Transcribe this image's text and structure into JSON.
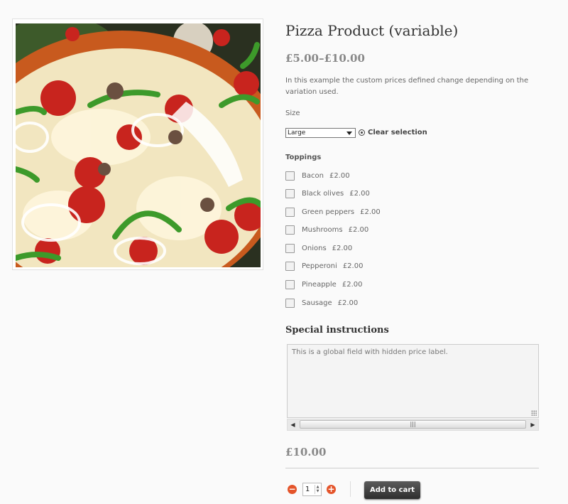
{
  "product": {
    "title": "Pizza Product (variable)",
    "price_range": "£5.00–£10.00",
    "description": "In this example the custom prices defined change depending on the variation used.",
    "image_icon": "pizza-photo"
  },
  "variation": {
    "label": "Size",
    "selected": "Large",
    "clear_label": "Clear selection"
  },
  "toppings": {
    "label": "Toppings",
    "items": [
      {
        "name": "Bacon",
        "price": "£2.00",
        "checked": false
      },
      {
        "name": "Black olives",
        "price": "£2.00",
        "checked": false
      },
      {
        "name": "Green peppers",
        "price": "£2.00",
        "checked": false
      },
      {
        "name": "Mushrooms",
        "price": "£2.00",
        "checked": false
      },
      {
        "name": "Onions",
        "price": "£2.00",
        "checked": false
      },
      {
        "name": "Pepperoni",
        "price": "£2.00",
        "checked": false
      },
      {
        "name": "Pineapple",
        "price": "£2.00",
        "checked": false
      },
      {
        "name": "Sausage",
        "price": "£2.00",
        "checked": false
      }
    ]
  },
  "special": {
    "heading": "Special instructions",
    "placeholder": "This is a global field with hidden price label."
  },
  "total": "£10.00",
  "cart": {
    "quantity": "1",
    "add_label": "Add to cart"
  },
  "colors": {
    "accent": "#e4542a",
    "button": "#3a3a3a"
  }
}
